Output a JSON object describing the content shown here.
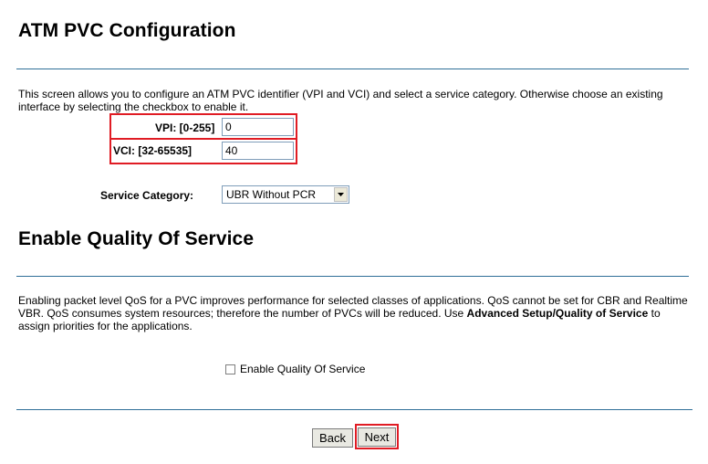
{
  "atm": {
    "title": "ATM PVC Configuration",
    "description": "This screen allows you to configure an ATM PVC identifier (VPI and VCI) and select a service category. Otherwise choose an existing interface by selecting the checkbox to enable it.",
    "vpi_label": "VPI: [0-255]",
    "vpi_value": "0",
    "vci_label": "VCI: [32-65535]",
    "vci_value": "40",
    "service_category_label": "Service Category:",
    "service_category_value": "UBR Without PCR"
  },
  "qos": {
    "title": "Enable Quality Of Service",
    "desc_part1": "Enabling packet level QoS for a PVC improves performance for selected classes of applications.  QoS cannot be set for CBR and Realtime VBR.  QoS consumes system resources; therefore the number of PVCs will be reduced. Use ",
    "desc_bold": "Advanced Setup/Quality of Service",
    "desc_part2": " to assign priorities for the applications.",
    "checkbox_label": "Enable Quality Of Service",
    "checkbox_checked": false
  },
  "buttons": {
    "back": "Back",
    "next": "Next"
  },
  "colors": {
    "highlight": "#e01c24",
    "rule": "#2f6f98"
  }
}
